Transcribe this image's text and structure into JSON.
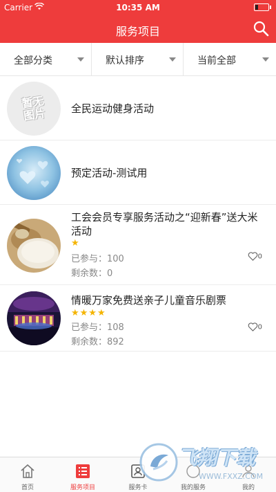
{
  "status": {
    "carrier": "Carrier",
    "time": "10:35 AM"
  },
  "header": {
    "title": "服务项目",
    "search_icon": "search-icon"
  },
  "filters": [
    {
      "label": "全部分类"
    },
    {
      "label": "默认排序"
    },
    {
      "label": "当前全部"
    }
  ],
  "items": [
    {
      "title": "全民运动健身活动",
      "thumb": "placeholder",
      "placeholder_text": "暂无图片"
    },
    {
      "title": "预定活动-测试用",
      "thumb": "hearts"
    },
    {
      "title": "工会会员专享服务活动之“迎新春”送大米活动",
      "thumb": "rice",
      "stars": 1,
      "joined_label": "已参与：",
      "joined": "100",
      "remain_label": "剩余数：",
      "remain": "0",
      "likes": "0"
    },
    {
      "title": "情暖万家免费送亲子儿童音乐剧票",
      "thumb": "stage",
      "stars": 4,
      "joined_label": "已参与：",
      "joined": "108",
      "remain_label": "剩余数：",
      "remain": "892",
      "likes": "0"
    }
  ],
  "tabs": [
    {
      "label": "首页",
      "icon": "home-icon"
    },
    {
      "label": "服务项目",
      "icon": "list-icon",
      "active": true
    },
    {
      "label": "服务卡",
      "icon": "card-icon"
    },
    {
      "label": "我的服务",
      "icon": "service-icon"
    },
    {
      "label": "我的",
      "icon": "user-icon"
    }
  ],
  "watermark": {
    "brand": "飞翔下载",
    "url": "WWW.FXXZ.COM"
  },
  "colors": {
    "accent": "#ee3c3c",
    "star": "#f4b400"
  }
}
